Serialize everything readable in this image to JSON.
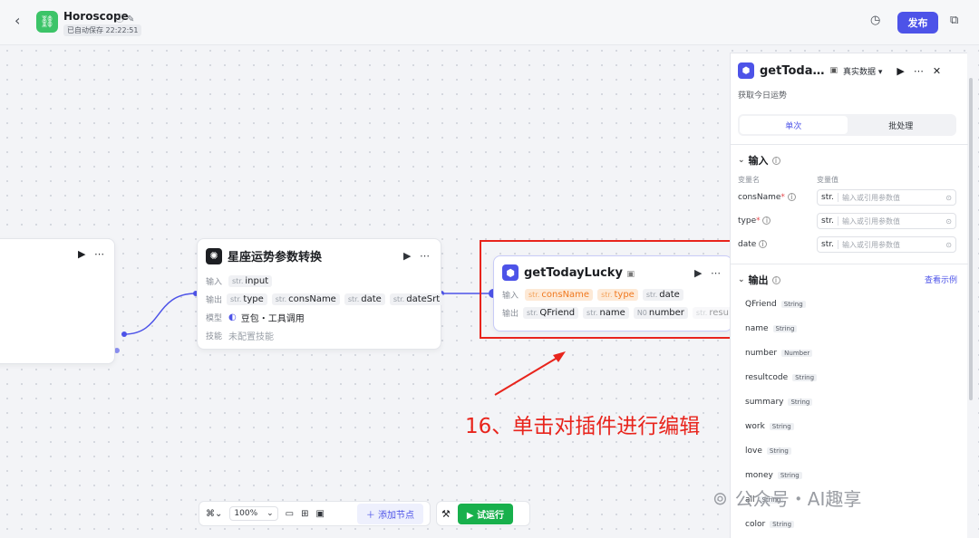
{
  "app": {
    "title": "Horoscope",
    "saved_status": "已自动保存 22:22:51",
    "publish_label": "发布"
  },
  "node_convert": {
    "title": "星座运势参数转换",
    "input_label": "输入",
    "output_label": "输出",
    "model_label": "模型",
    "skill_label": "技能",
    "inputs": [
      {
        "type": "str.",
        "name": "input"
      }
    ],
    "outputs": [
      {
        "type": "str.",
        "name": "type"
      },
      {
        "type": "str.",
        "name": "consName"
      },
      {
        "type": "str.",
        "name": "date"
      },
      {
        "type": "str.",
        "name": "dateSrt"
      }
    ],
    "model_value": "豆包・工具调用",
    "skill_value": "未配置技能"
  },
  "node_lucky": {
    "title": "getTodayLucky",
    "input_label": "输入",
    "output_label": "输出",
    "inputs": [
      {
        "type": "str.",
        "name": "consName"
      },
      {
        "type": "str.",
        "name": "type"
      },
      {
        "type": "str.",
        "name": "date"
      }
    ],
    "outputs": [
      {
        "type": "str.",
        "name": "QFriend"
      },
      {
        "type": "str.",
        "name": "name"
      },
      {
        "type": "N0",
        "name": "number"
      },
      {
        "type": "str.",
        "name": "resu"
      }
    ]
  },
  "panel": {
    "title": "getToda…",
    "data_mode": "真实数据",
    "description": "获取今日运势",
    "tabs": [
      "单次",
      "批处理"
    ],
    "input_section": "输入",
    "col_var_name": "变量名",
    "col_var_value": "变量值",
    "variables": [
      {
        "name": "consName",
        "required": "*",
        "type": "str.",
        "placeholder": "输入或引用参数值"
      },
      {
        "name": "type",
        "required": "*",
        "type": "str.",
        "placeholder": "输入或引用参数值"
      },
      {
        "name": "date",
        "required": "",
        "type": "str.",
        "placeholder": "输入或引用参数值"
      }
    ],
    "output_section": "输出",
    "view_example": "查看示例",
    "outputs": [
      {
        "name": "QFriend",
        "type": "String"
      },
      {
        "name": "name",
        "type": "String"
      },
      {
        "name": "number",
        "type": "Number"
      },
      {
        "name": "resultcode",
        "type": "String"
      },
      {
        "name": "summary",
        "type": "String"
      },
      {
        "name": "work",
        "type": "String"
      },
      {
        "name": "love",
        "type": "String"
      },
      {
        "name": "money",
        "type": "String"
      },
      {
        "name": "all",
        "type": "String"
      },
      {
        "name": "color",
        "type": "String"
      }
    ]
  },
  "toolbar": {
    "zoom": "100%",
    "add_node": "添加节点",
    "run": "试运行"
  },
  "annotation": "16、单击对插件进行编辑",
  "watermark": "公众号・AI趣享",
  "colors": {
    "accent": "#4d53e8",
    "run": "#18b04c",
    "annotation": "#e8241c"
  }
}
